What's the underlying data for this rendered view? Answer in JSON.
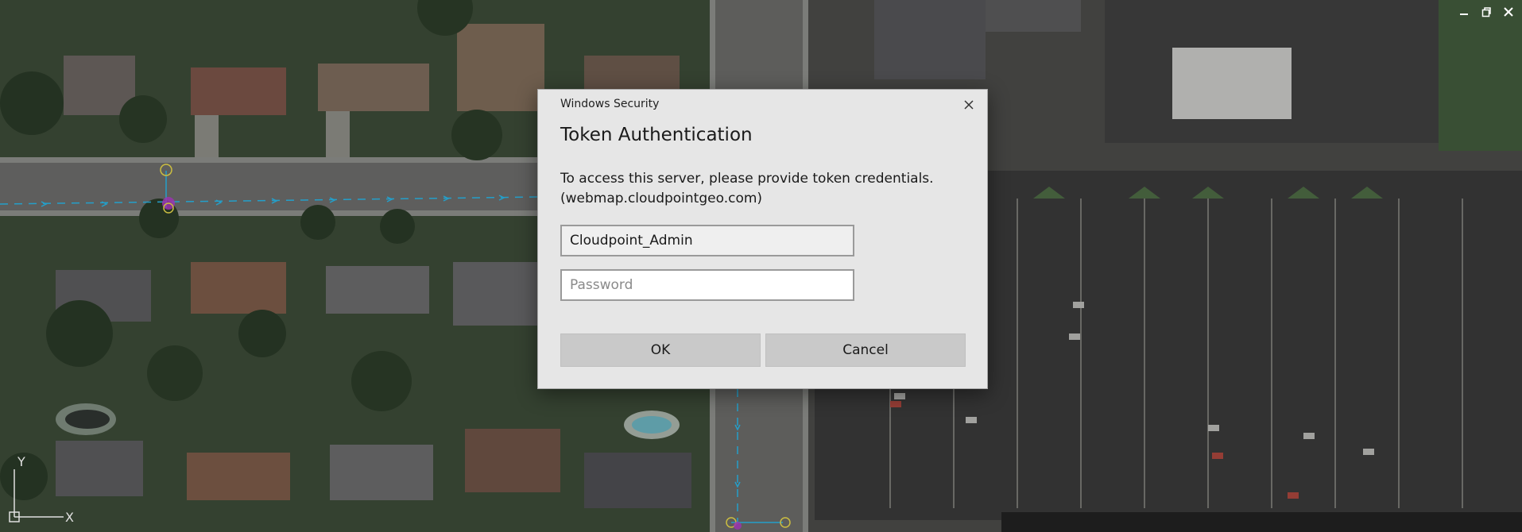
{
  "window": {
    "controls": [
      {
        "icon": "minimize-icon"
      },
      {
        "icon": "restore-icon"
      },
      {
        "icon": "close-icon"
      }
    ]
  },
  "ucs": {
    "y_label": "Y",
    "x_label": "X"
  },
  "dialog": {
    "caption": "Windows Security",
    "title": "Token Authentication",
    "message_line1": "To access this server, please provide token credentials.",
    "message_line2": "(webmap.cloudpointgeo.com)",
    "username_value": "Cloudpoint_Admin",
    "password_placeholder": "Password",
    "ok_label": "OK",
    "cancel_label": "Cancel"
  },
  "colors": {
    "line_cyan": "#29b6e6",
    "node_yellow": "#e8d84a",
    "node_magenta": "#b03cc8"
  }
}
